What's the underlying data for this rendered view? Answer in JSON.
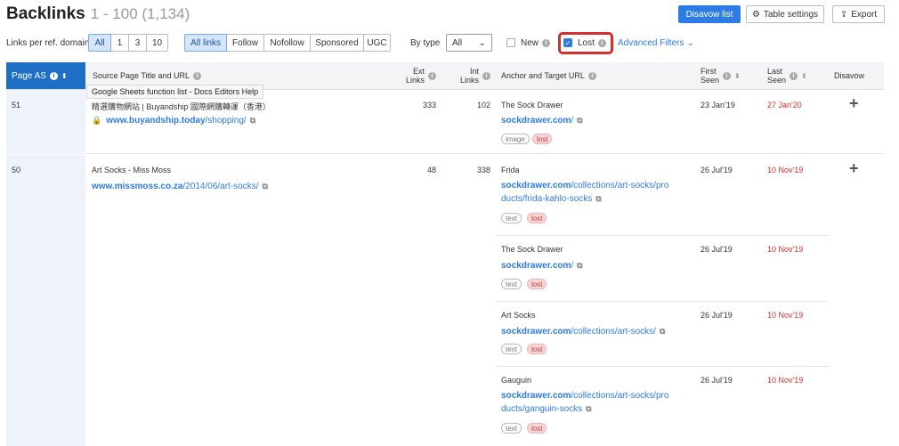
{
  "header": {
    "title": "Backlinks",
    "range": "1 - 100 (1,134)"
  },
  "toolbar": {
    "disavow_label": "Disavow list",
    "table_settings_label": "Table settings",
    "export_label": "Export"
  },
  "filters": {
    "links_per_domain_label": "Links per ref. domain",
    "links_per_domain_options": [
      "All",
      "1",
      "3",
      "10"
    ],
    "link_type_options": [
      "All links",
      "Follow",
      "Nofollow",
      "Sponsored",
      "UGC"
    ],
    "by_type_label": "By type",
    "by_type_value": "All",
    "new_label": "New",
    "lost_label": "Lost",
    "advanced_label": "Advanced Filters"
  },
  "columns": {
    "page_as": "Page AS",
    "source": "Source Page Title and URL",
    "ext_links_1": "Ext",
    "ext_links_2": "Links",
    "int_links_1": "Int",
    "int_links_2": "Links",
    "anchor": "Anchor and Target URL",
    "first_seen_1": "First",
    "first_seen_2": "Seen",
    "last_seen_1": "Last",
    "last_seen_2": "Seen",
    "disavow": "Disavow"
  },
  "tooltip": "Google Sheets function list - Docs Editors Help",
  "rows": [
    {
      "page_as": "51",
      "source_title": "精選購物網站 | Buyandship 國際網購轉運（香港）",
      "source_domain": "www.buyandship.today",
      "source_path": "/shopping/",
      "ext_links": "333",
      "int_links": "102",
      "anchors": [
        {
          "anchor": "The Sock Drawer",
          "domain": "sockdrawer.com",
          "path_l1": "/",
          "path_l2": "",
          "tag1": "image",
          "tag2": "lost",
          "first_seen": "23 Jan'19",
          "last_seen": "27 Jan'20"
        }
      ]
    },
    {
      "page_as": "50",
      "source_title": "Art Socks - Miss Moss",
      "source_domain": "www.missmoss.co.za",
      "source_path": "/2014/06/art-socks/",
      "ext_links": "48",
      "int_links": "338",
      "anchors": [
        {
          "anchor": "Frida",
          "domain": "sockdrawer.com",
          "path_l1": "/collections/art-socks/pro",
          "path_l2": "ducts/frida-kahlo-socks",
          "tag1": "text",
          "tag2": "lost",
          "first_seen": "26 Jul'19",
          "last_seen": "10 Nov'19"
        },
        {
          "anchor": "The Sock Drawer",
          "domain": "sockdrawer.com",
          "path_l1": "/",
          "path_l2": "",
          "tag1": "text",
          "tag2": "lost",
          "first_seen": "26 Jul'19",
          "last_seen": "10 Nov'19"
        },
        {
          "anchor": "Art Socks",
          "domain": "sockdrawer.com",
          "path_l1": "/collections/art-socks/",
          "path_l2": "",
          "tag1": "text",
          "tag2": "lost",
          "first_seen": "26 Jul'19",
          "last_seen": "10 Nov'19"
        },
        {
          "anchor": "Gauguin",
          "domain": "sockdrawer.com",
          "path_l1": "/collections/art-socks/pro",
          "path_l2": "ducts/ganguin-socks",
          "tag1": "text",
          "tag2": "lost",
          "first_seen": "26 Jul'19",
          "last_seen": "10 Nov'19"
        }
      ]
    }
  ]
}
